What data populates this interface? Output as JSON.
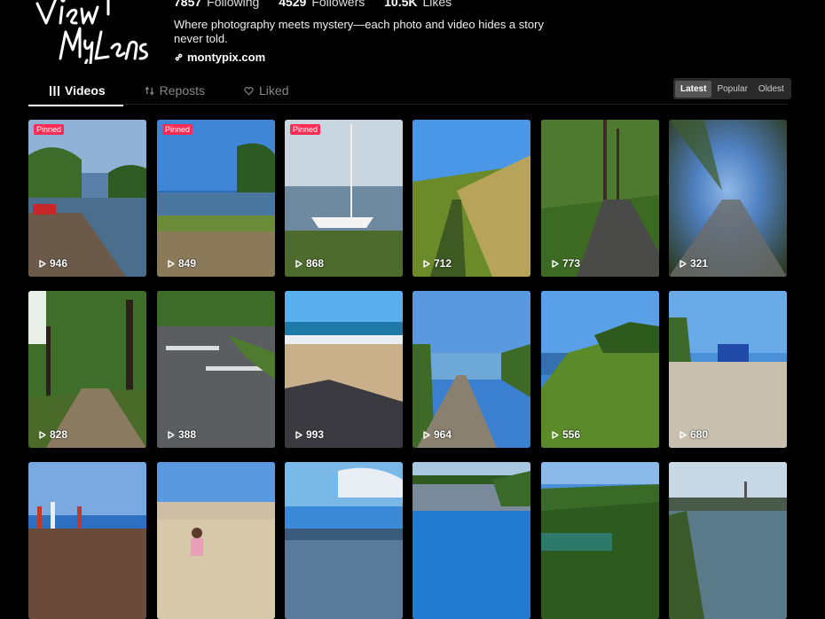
{
  "profile": {
    "following_count": "7857",
    "following_label": "Following",
    "followers_count": "4529",
    "followers_label": "Followers",
    "likes_count": "10.5K",
    "likes_label": "Likes",
    "bio": "Where photography meets mystery—each photo and video hides a story never told.",
    "website": "montypix.com",
    "logo_text": "View My Lens"
  },
  "tabs": [
    {
      "label": "Videos",
      "icon": "grid-icon",
      "active": true
    },
    {
      "label": "Reposts",
      "icon": "repost-icon",
      "active": false
    },
    {
      "label": "Liked",
      "icon": "heart-icon",
      "active": false
    }
  ],
  "sort": [
    {
      "label": "Latest",
      "active": true
    },
    {
      "label": "Popular",
      "active": false
    },
    {
      "label": "Oldest",
      "active": false
    }
  ],
  "pinned_label": "Pinned",
  "videos": [
    {
      "views": "946",
      "pinned": true,
      "theme": "lake-pier"
    },
    {
      "views": "849",
      "pinned": true,
      "theme": "lake-shore"
    },
    {
      "views": "868",
      "pinned": true,
      "theme": "sailboat"
    },
    {
      "views": "712",
      "pinned": false,
      "theme": "cornfield"
    },
    {
      "views": "773",
      "pinned": false,
      "theme": "path-trees"
    },
    {
      "views": "321",
      "pinned": false,
      "theme": "motion-blur"
    },
    {
      "views": "828",
      "pinned": false,
      "theme": "tree-alley"
    },
    {
      "views": "388",
      "pinned": false,
      "theme": "marina"
    },
    {
      "views": "993",
      "pinned": false,
      "theme": "beach-shadow"
    },
    {
      "views": "964",
      "pinned": false,
      "theme": "boardwalk"
    },
    {
      "views": "556",
      "pinned": false,
      "theme": "cliff-coast"
    },
    {
      "views": "680",
      "pinned": false,
      "theme": "sandy-beach"
    },
    {
      "views": "",
      "pinned": false,
      "theme": "festival"
    },
    {
      "views": "",
      "pinned": false,
      "theme": "beach-walk"
    },
    {
      "views": "",
      "pinned": false,
      "theme": "sky-sea"
    },
    {
      "views": "",
      "pinned": false,
      "theme": "pool"
    },
    {
      "views": "",
      "pinned": false,
      "theme": "green-valley"
    },
    {
      "views": "",
      "pinned": false,
      "theme": "river-town"
    }
  ]
}
